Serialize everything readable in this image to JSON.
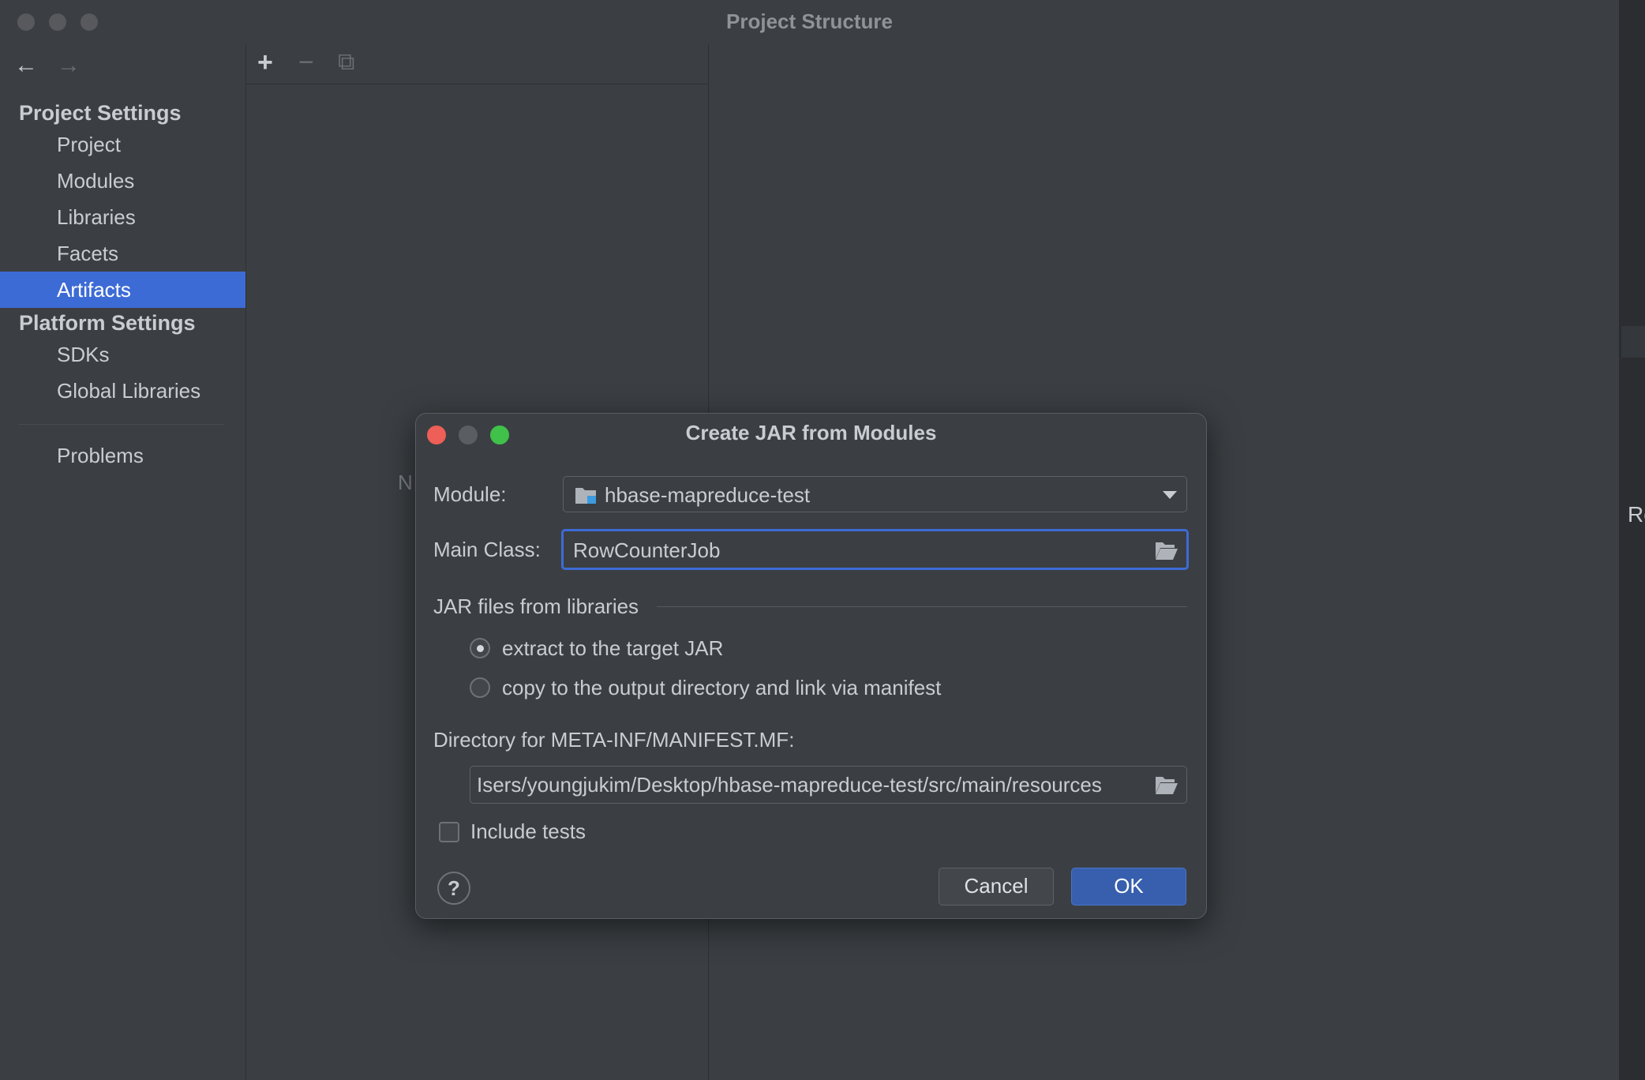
{
  "window": {
    "title": "Project Structure"
  },
  "sidebar": {
    "back_glyph": "←",
    "forward_glyph": "→",
    "project_settings_title": "Project Settings",
    "project_items": [
      {
        "label": "Project"
      },
      {
        "label": "Modules"
      },
      {
        "label": "Libraries"
      },
      {
        "label": "Facets"
      },
      {
        "label": "Artifacts",
        "selected": true
      }
    ],
    "platform_settings_title": "Platform Settings",
    "platform_items": [
      {
        "label": "SDKs"
      },
      {
        "label": "Global Libraries"
      }
    ],
    "problems_label": "Problems"
  },
  "list_toolbar": {
    "add_glyph": "+",
    "remove_glyph": "−",
    "copy_glyph": "⧉"
  },
  "list_pane": {
    "peek_text": "N"
  },
  "outer_peek_text": "Re",
  "dialog": {
    "title": "Create JAR from Modules",
    "module_label": "Module:",
    "module_value": "hbase-mapreduce-test",
    "main_class_label": "Main Class:",
    "main_class_value": "RowCounterJob",
    "jar_section_title": "JAR files from libraries",
    "radio_extract_label": "extract to the target JAR",
    "radio_copy_label": "copy to the output directory and link via manifest",
    "radio_selected": "extract",
    "manifest_dir_label": "Directory for META-INF/MANIFEST.MF:",
    "manifest_dir_value": "Isers/youngjukim/Desktop/hbase-mapreduce-test/src/main/resources",
    "include_tests_label": "Include tests",
    "include_tests_checked": false,
    "help_glyph": "?",
    "cancel_label": "Cancel",
    "ok_label": "OK"
  },
  "colors": {
    "accent": "#3d6bd6",
    "ok_button": "#375fad",
    "close_light": "#ed5f57",
    "minimize_light_inactive": "#5a5d61",
    "zoom_light": "#3fc14a"
  }
}
